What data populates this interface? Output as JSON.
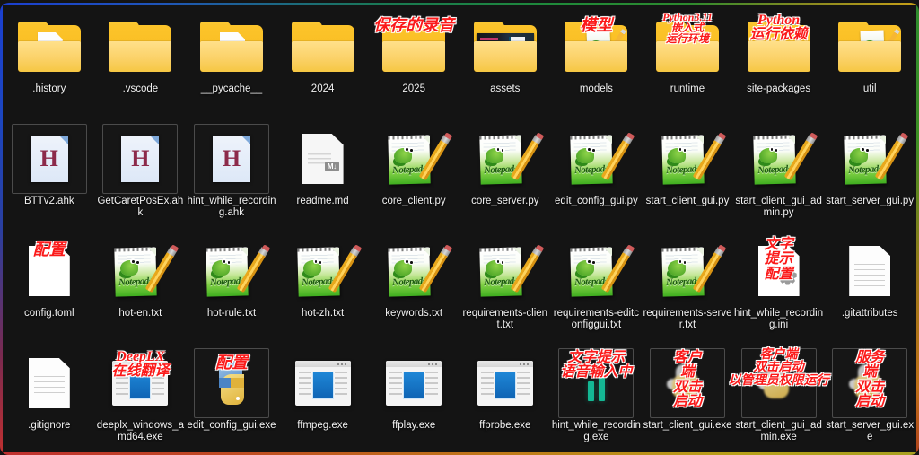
{
  "window": {
    "title": "File Explorer Desktop Icon Grid",
    "background_color": "#141414",
    "label_color": "#f2f2f2",
    "annotation_color": "#fb1a1a",
    "border_gradient": [
      "#1b3fd0",
      "#2e8b2e",
      "#c8a018",
      "#c03030"
    ]
  },
  "files": [
    {
      "name": ".history",
      "icon": "folder-with-document",
      "annotation": "",
      "selected": false
    },
    {
      "name": ".vscode",
      "icon": "folder-plain",
      "annotation": "",
      "selected": false
    },
    {
      "name": "__pycache__",
      "icon": "folder-with-document",
      "annotation": "",
      "selected": false
    },
    {
      "name": "2024",
      "icon": "folder-plain",
      "annotation": "",
      "selected": false
    },
    {
      "name": "2025",
      "icon": "folder-plain",
      "annotation": "保存的录音",
      "selected": false
    },
    {
      "name": "assets",
      "icon": "folder-thumbnail",
      "annotation": "",
      "selected": false
    },
    {
      "name": "models",
      "icon": "folder-notepad",
      "annotation": "模型",
      "selected": false
    },
    {
      "name": "runtime",
      "icon": "folder-plain",
      "annotation": "Python3.11\n嵌入式\n运行环境",
      "selected": false
    },
    {
      "name": "site-packages",
      "icon": "folder-plain",
      "annotation": "Python\n运行依赖",
      "selected": false
    },
    {
      "name": "util",
      "icon": "folder-notepad",
      "annotation": "",
      "selected": false
    },
    {
      "name": "BTTv2.ahk",
      "icon": "ahk-script",
      "annotation": "",
      "selected": true
    },
    {
      "name": "GetCaretPosEx.ahk",
      "icon": "ahk-script",
      "annotation": "",
      "selected": true
    },
    {
      "name": "hint_while_recording.ahk",
      "icon": "ahk-script",
      "annotation": "",
      "selected": true
    },
    {
      "name": "readme.md",
      "icon": "markdown-doc",
      "annotation": "",
      "selected": false
    },
    {
      "name": "core_client.py",
      "icon": "notepad-plus-plus",
      "annotation": "",
      "selected": false
    },
    {
      "name": "core_server.py",
      "icon": "notepad-plus-plus",
      "annotation": "",
      "selected": false
    },
    {
      "name": "edit_config_gui.py",
      "icon": "notepad-plus-plus",
      "annotation": "",
      "selected": false
    },
    {
      "name": "start_client_gui.py",
      "icon": "notepad-plus-plus",
      "annotation": "",
      "selected": false
    },
    {
      "name": "start_client_gui_admin.py",
      "icon": "notepad-plus-plus",
      "annotation": "",
      "selected": false
    },
    {
      "name": "start_server_gui.py",
      "icon": "notepad-plus-plus",
      "annotation": "",
      "selected": false
    },
    {
      "name": "config.toml",
      "icon": "white-doc",
      "annotation": "配置",
      "selected": false
    },
    {
      "name": "hot-en.txt",
      "icon": "notepad-plus-plus",
      "annotation": "",
      "selected": false
    },
    {
      "name": "hot-rule.txt",
      "icon": "notepad-plus-plus",
      "annotation": "",
      "selected": false
    },
    {
      "name": "hot-zh.txt",
      "icon": "notepad-plus-plus",
      "annotation": "",
      "selected": false
    },
    {
      "name": "keywords.txt",
      "icon": "notepad-plus-plus",
      "annotation": "",
      "selected": false
    },
    {
      "name": "requirements-client.txt",
      "icon": "notepad-plus-plus",
      "annotation": "",
      "selected": false
    },
    {
      "name": "requirements-editconfiggui.txt",
      "icon": "notepad-plus-plus",
      "annotation": "",
      "selected": false
    },
    {
      "name": "requirements-server.txt",
      "icon": "notepad-plus-plus",
      "annotation": "",
      "selected": false
    },
    {
      "name": "hint_while_recording.ini",
      "icon": "ini-gear-doc",
      "annotation": "文字提示\n配置",
      "selected": false
    },
    {
      "name": ".gitattributes",
      "icon": "plain-doc",
      "annotation": "",
      "selected": false
    },
    {
      "name": ".gitignore",
      "icon": "plain-doc",
      "annotation": "",
      "selected": false
    },
    {
      "name": "deeplx_windows_amd64.exe",
      "icon": "exe-window",
      "annotation": "DeepLX\n在线翻译",
      "selected": false
    },
    {
      "name": "edit_config_gui.exe",
      "icon": "python-logo",
      "annotation": "配置",
      "selected": true
    },
    {
      "name": "ffmpeg.exe",
      "icon": "exe-window",
      "annotation": "",
      "selected": false
    },
    {
      "name": "ffplay.exe",
      "icon": "exe-window",
      "annotation": "",
      "selected": false
    },
    {
      "name": "ffprobe.exe",
      "icon": "exe-window",
      "annotation": "",
      "selected": false
    },
    {
      "name": "hint_while_recording.exe",
      "icon": "audio-bars",
      "annotation": "文字提示\n语音输入中",
      "selected": true
    },
    {
      "name": "start_client_gui.exe",
      "icon": "python-blurred",
      "annotation": "客户端\n双击启动",
      "selected": true
    },
    {
      "name": "start_client_gui_admin.exe",
      "icon": "python-blurred",
      "annotation": "客户端\n双击启动\n以管理员权限运行",
      "selected": true
    },
    {
      "name": "start_server_gui.exe",
      "icon": "python-blurred",
      "annotation": "服务端\n双击启动",
      "selected": true
    }
  ]
}
